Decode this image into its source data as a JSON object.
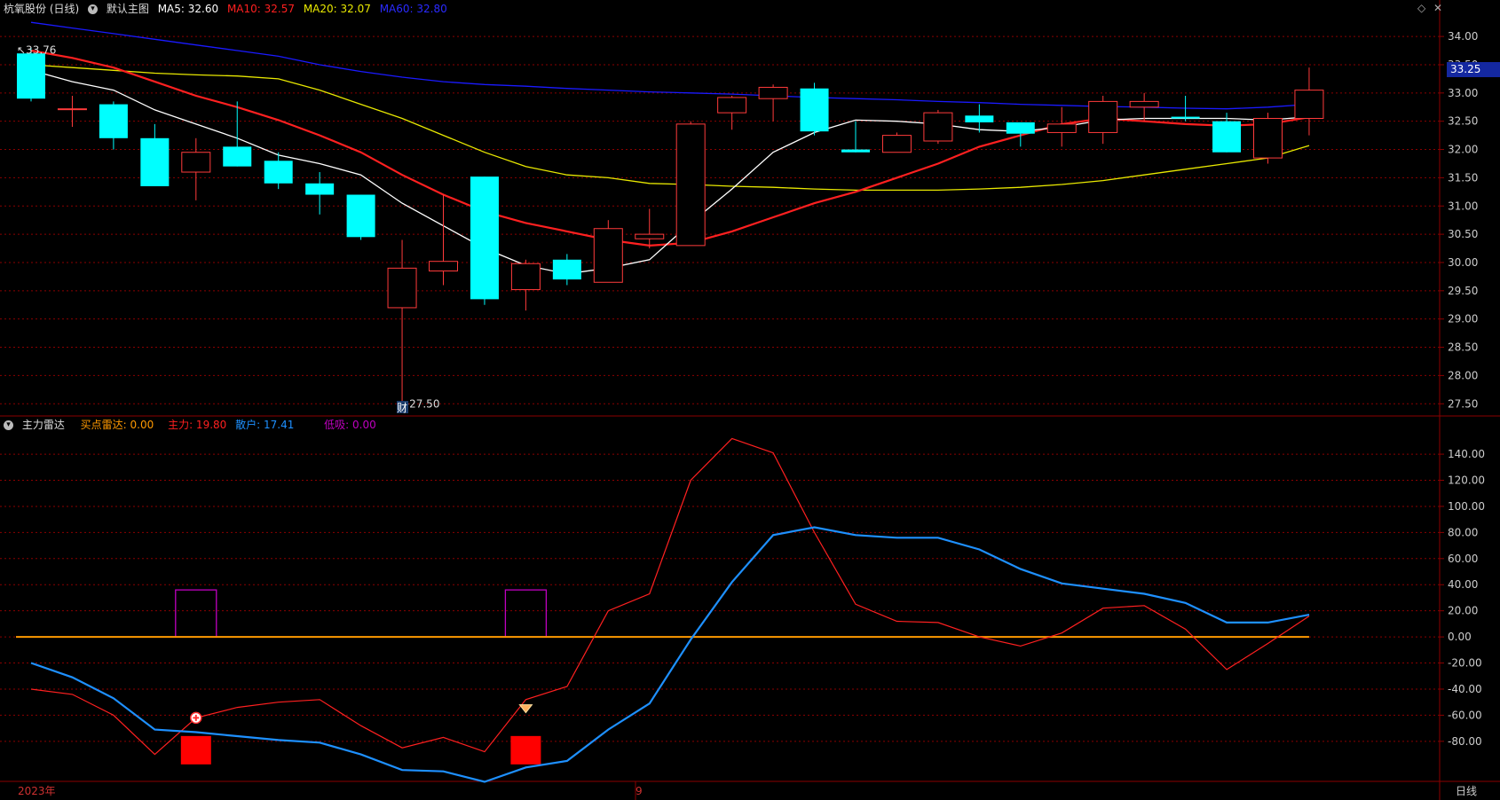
{
  "top_panel": {
    "stock": "杭氧股份 (日线)",
    "menu": "默认主图",
    "ma5": "MA5: 32.60",
    "ma10": "MA10: 32.57",
    "ma20": "MA20: 32.07",
    "ma60": "MA60: 32.80"
  },
  "bottom_panel": {
    "title": "主力雷达",
    "buy_radar": "买点雷达: 0.00",
    "main": "主力: 19.80",
    "retail": "散户: 17.41",
    "low_suck": "低吸: 0.00"
  },
  "footer": {
    "year": "2023年",
    "month": "9",
    "period": "日线"
  },
  "price_label": "33.25",
  "icons": [
    "chevron-down-icon",
    "diamond-icon",
    "close-icon",
    "plus-circle-icon",
    "diamond-marker-icon"
  ],
  "colors": {
    "up": "#ff3b3b",
    "down": "#00ffff",
    "ma5": "#ffffff",
    "ma10": "#ff2020",
    "ma20": "#e8e800",
    "ma60": "#1a1aff",
    "grid": "#8b0000",
    "zero": "#ff9900",
    "main_line": "#ff2020",
    "retail_line": "#1e90ff",
    "low_suck": "#c000c0"
  },
  "chart_data": [
    {
      "type": "candlestick",
      "title": "杭氧股份 (日线)",
      "ylim": [
        27.3,
        34.3
      ],
      "y_ticks": [
        "34.00",
        "33.50",
        "33.00",
        "32.50",
        "32.00",
        "31.50",
        "31.00",
        "30.50",
        "30.00",
        "29.50",
        "29.00",
        "28.50",
        "28.00",
        "27.50"
      ],
      "candles": [
        {
          "o": 33.7,
          "h": 33.8,
          "l": 32.85,
          "c": 32.9
        },
        {
          "o": 32.72,
          "h": 32.95,
          "l": 32.4,
          "c": 32.72
        },
        {
          "o": 32.8,
          "h": 32.85,
          "l": 32.0,
          "c": 32.2
        },
        {
          "o": 32.2,
          "h": 32.45,
          "l": 31.35,
          "c": 31.35
        },
        {
          "o": 31.6,
          "h": 32.2,
          "l": 31.1,
          "c": 31.95
        },
        {
          "o": 32.05,
          "h": 32.85,
          "l": 31.7,
          "c": 31.7
        },
        {
          "o": 31.8,
          "h": 31.95,
          "l": 31.3,
          "c": 31.4
        },
        {
          "o": 31.4,
          "h": 31.6,
          "l": 30.85,
          "c": 31.2
        },
        {
          "o": 31.2,
          "h": 31.2,
          "l": 30.4,
          "c": 30.45
        },
        {
          "o": 29.2,
          "h": 30.4,
          "l": 27.5,
          "c": 29.9
        },
        {
          "o": 29.85,
          "h": 31.2,
          "l": 29.6,
          "c": 30.02
        },
        {
          "o": 31.52,
          "h": 31.52,
          "l": 29.25,
          "c": 29.35
        },
        {
          "o": 29.52,
          "h": 30.05,
          "l": 29.15,
          "c": 29.98
        },
        {
          "o": 30.05,
          "h": 30.15,
          "l": 29.6,
          "c": 29.7
        },
        {
          "o": 29.65,
          "h": 30.75,
          "l": 29.65,
          "c": 30.6
        },
        {
          "o": 30.42,
          "h": 30.95,
          "l": 30.25,
          "c": 30.5
        },
        {
          "o": 30.3,
          "h": 32.5,
          "l": 30.3,
          "c": 32.45
        },
        {
          "o": 32.65,
          "h": 32.95,
          "l": 32.35,
          "c": 32.92
        },
        {
          "o": 32.9,
          "h": 33.15,
          "l": 32.5,
          "c": 33.1
        },
        {
          "o": 33.08,
          "h": 33.18,
          "l": 32.25,
          "c": 32.32
        },
        {
          "o": 32.0,
          "h": 32.5,
          "l": 31.95,
          "c": 31.95
        },
        {
          "o": 31.95,
          "h": 32.3,
          "l": 31.95,
          "c": 32.25
        },
        {
          "o": 32.15,
          "h": 32.7,
          "l": 32.1,
          "c": 32.65
        },
        {
          "o": 32.6,
          "h": 32.8,
          "l": 32.3,
          "c": 32.48
        },
        {
          "o": 32.48,
          "h": 32.48,
          "l": 32.05,
          "c": 32.28
        },
        {
          "o": 32.3,
          "h": 32.75,
          "l": 32.05,
          "c": 32.45
        },
        {
          "o": 32.3,
          "h": 32.95,
          "l": 32.1,
          "c": 32.85
        },
        {
          "o": 32.75,
          "h": 33.0,
          "l": 32.5,
          "c": 32.85
        },
        {
          "o": 32.58,
          "h": 32.95,
          "l": 32.5,
          "c": 32.55
        },
        {
          "o": 32.5,
          "h": 32.65,
          "l": 31.95,
          "c": 31.95
        },
        {
          "o": 31.85,
          "h": 32.65,
          "l": 31.75,
          "c": 32.55
        },
        {
          "o": 32.55,
          "h": 33.45,
          "l": 32.25,
          "c": 33.05
        }
      ],
      "ma5": [
        33.4,
        33.2,
        33.05,
        32.7,
        32.45,
        32.2,
        31.9,
        31.75,
        31.55,
        31.05,
        30.65,
        30.25,
        29.95,
        29.8,
        29.9,
        30.05,
        30.7,
        31.3,
        31.95,
        32.3,
        32.52,
        32.5,
        32.45,
        32.35,
        32.32,
        32.4,
        32.52,
        32.55,
        32.55,
        32.55,
        32.52,
        32.58
      ],
      "ma10": [
        33.75,
        33.62,
        33.45,
        33.2,
        32.95,
        32.75,
        32.52,
        32.25,
        31.95,
        31.55,
        31.2,
        30.9,
        30.7,
        30.55,
        30.4,
        30.3,
        30.35,
        30.55,
        30.8,
        31.05,
        31.25,
        31.5,
        31.75,
        32.05,
        32.25,
        32.45,
        32.55,
        32.5,
        32.45,
        32.42,
        32.45,
        32.57
      ],
      "ma20": [
        33.5,
        33.45,
        33.4,
        33.35,
        33.32,
        33.3,
        33.25,
        33.05,
        32.8,
        32.55,
        32.25,
        31.95,
        31.7,
        31.55,
        31.5,
        31.4,
        31.38,
        31.35,
        31.33,
        31.3,
        31.28,
        31.28,
        31.28,
        31.3,
        31.33,
        31.38,
        31.45,
        31.55,
        31.65,
        31.75,
        31.85,
        32.07
      ],
      "ma60": [
        34.25,
        34.15,
        34.05,
        33.95,
        33.85,
        33.75,
        33.65,
        33.5,
        33.38,
        33.28,
        33.2,
        33.15,
        33.12,
        33.08,
        33.05,
        33.02,
        33.0,
        32.98,
        32.95,
        32.92,
        32.9,
        32.88,
        32.85,
        32.83,
        32.8,
        32.78,
        32.76,
        32.75,
        32.73,
        32.72,
        32.75,
        32.8
      ],
      "annotations": [
        {
          "text": "33.76",
          "at": "high"
        },
        {
          "text": "←27.50",
          "at": "low"
        },
        {
          "text": "财",
          "at": "low"
        }
      ]
    },
    {
      "type": "line",
      "title": "主力雷达",
      "ylim": [
        -110,
        155
      ],
      "y_ticks": [
        "140.00",
        "120.00",
        "100.00",
        "80.00",
        "60.00",
        "40.00",
        "20.00",
        "0.00",
        "-20.00",
        "-40.00",
        "-60.00",
        "-80.00"
      ],
      "series": [
        {
          "name": "主力",
          "values": [
            -40,
            -44,
            -60,
            -90,
            -62,
            -54,
            -50,
            -48,
            -68,
            -85,
            -77,
            -88,
            -48,
            -38,
            20,
            33,
            120,
            152,
            141,
            80,
            25,
            12,
            11,
            0,
            -7,
            3,
            22,
            24,
            6,
            -25,
            -5,
            16
          ]
        },
        {
          "name": "散户",
          "values": [
            -20,
            -31,
            -47,
            -71,
            -73,
            -76,
            -79,
            -81,
            -90,
            -102,
            -103,
            -111,
            -100,
            -95,
            -71,
            -51,
            -2,
            42,
            78,
            84,
            78,
            76,
            76,
            67,
            52,
            41,
            37,
            33,
            26,
            11,
            11,
            17
          ]
        }
      ],
      "bars": [
        {
          "index": 4,
          "value": 36,
          "series": "低吸"
        },
        {
          "index": 12,
          "value": 36,
          "series": "低吸"
        },
        {
          "index": 4,
          "value": -80,
          "series": "买点雷达"
        },
        {
          "index": 12,
          "value": -80,
          "series": "买点雷达"
        }
      ]
    }
  ]
}
